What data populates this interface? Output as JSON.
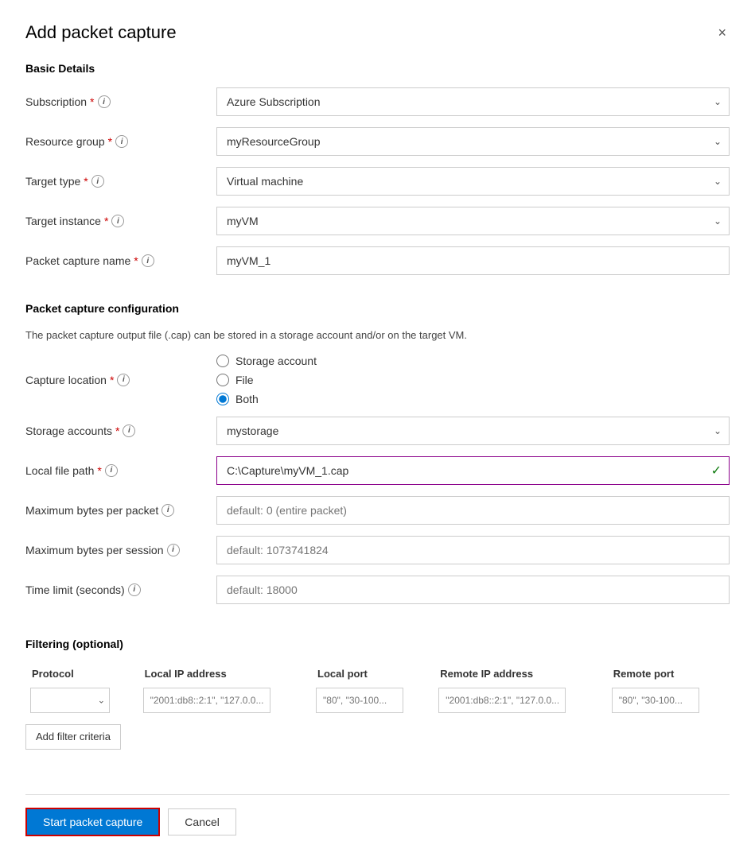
{
  "dialog": {
    "title": "Add packet capture",
    "close_label": "×"
  },
  "basic_details": {
    "section_title": "Basic Details",
    "subscription": {
      "label": "Subscription",
      "required": true,
      "value": "Azure Subscription"
    },
    "resource_group": {
      "label": "Resource group",
      "required": true,
      "value": "myResourceGroup"
    },
    "target_type": {
      "label": "Target type",
      "required": true,
      "value": "Virtual machine"
    },
    "target_instance": {
      "label": "Target instance",
      "required": true,
      "value": "myVM"
    },
    "packet_capture_name": {
      "label": "Packet capture name",
      "required": true,
      "value": "myVM_1"
    }
  },
  "packet_config": {
    "section_title": "Packet capture configuration",
    "description": "The packet capture output file (.cap) can be stored in a storage account and/or on the target VM.",
    "capture_location": {
      "label": "Capture location",
      "required": true,
      "options": [
        "Storage account",
        "File",
        "Both"
      ],
      "selected": "Both"
    },
    "storage_accounts": {
      "label": "Storage accounts",
      "required": true,
      "value": "mystorage"
    },
    "local_file_path": {
      "label": "Local file path",
      "required": true,
      "value": "C:\\Capture\\myVM_1.cap"
    },
    "max_bytes_packet": {
      "label": "Maximum bytes per packet",
      "placeholder": "default: 0 (entire packet)"
    },
    "max_bytes_session": {
      "label": "Maximum bytes per session",
      "placeholder": "default: 1073741824"
    },
    "time_limit": {
      "label": "Time limit (seconds)",
      "placeholder": "default: 18000"
    }
  },
  "filtering": {
    "section_title": "Filtering (optional)",
    "table_headers": [
      "Protocol",
      "Local IP address",
      "Local port",
      "Remote IP address",
      "Remote port"
    ],
    "row": {
      "protocol_placeholder": "",
      "local_ip_placeholder": "\"2001:db8::2:1\", \"127.0.0....",
      "local_port_placeholder": "\"80\", \"30-100...",
      "remote_ip_placeholder": "\"2001:db8::2:1\", \"127.0.0....",
      "remote_port_placeholder": "\"80\", \"30-100..."
    },
    "add_filter_label": "Add filter criteria"
  },
  "footer": {
    "start_label": "Start packet capture",
    "cancel_label": "Cancel"
  },
  "icons": {
    "info": "i",
    "chevron_down": "⌄",
    "close": "✕",
    "check": "✓"
  }
}
